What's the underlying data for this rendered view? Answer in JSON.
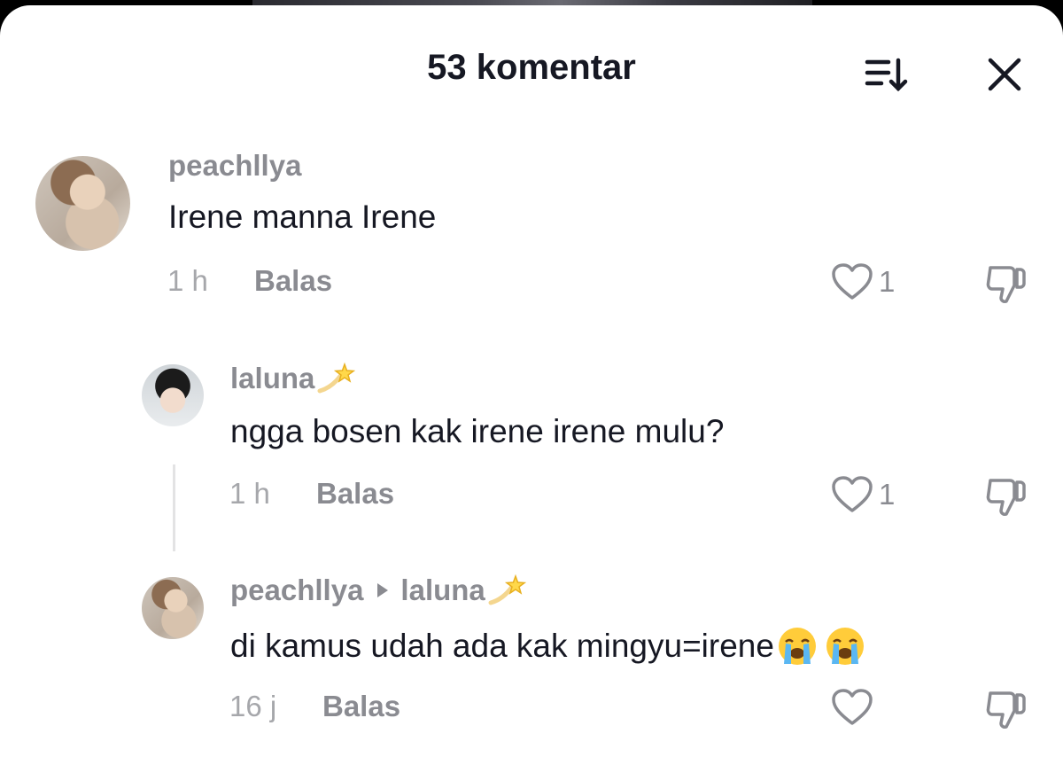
{
  "header": {
    "title": "53 komentar",
    "sort_icon": "sort-icon",
    "close_icon": "close-icon"
  },
  "comments": [
    {
      "username": "peachllya",
      "text": "Irene manna Irene",
      "time": "1 h",
      "reply_label": "Balas",
      "likes": "1"
    },
    {
      "username": "laluna",
      "username_emoji": "dizzy-star",
      "text": "ngga bosen kak irene irene mulu?",
      "time": "1 h",
      "reply_label": "Balas",
      "likes": "1"
    },
    {
      "username": "peachllya",
      "reply_to": "laluna",
      "reply_to_emoji": "dizzy-star",
      "text": "di kamus udah ada kak mingyu=irene",
      "text_emojis": [
        "loudly-crying-face",
        "loudly-crying-face"
      ],
      "time": "16 j",
      "reply_label": "Balas",
      "likes": ""
    }
  ],
  "colors": {
    "text_primary": "#161823",
    "text_secondary": "#8a8b91",
    "sheet_bg": "#ffffff"
  }
}
